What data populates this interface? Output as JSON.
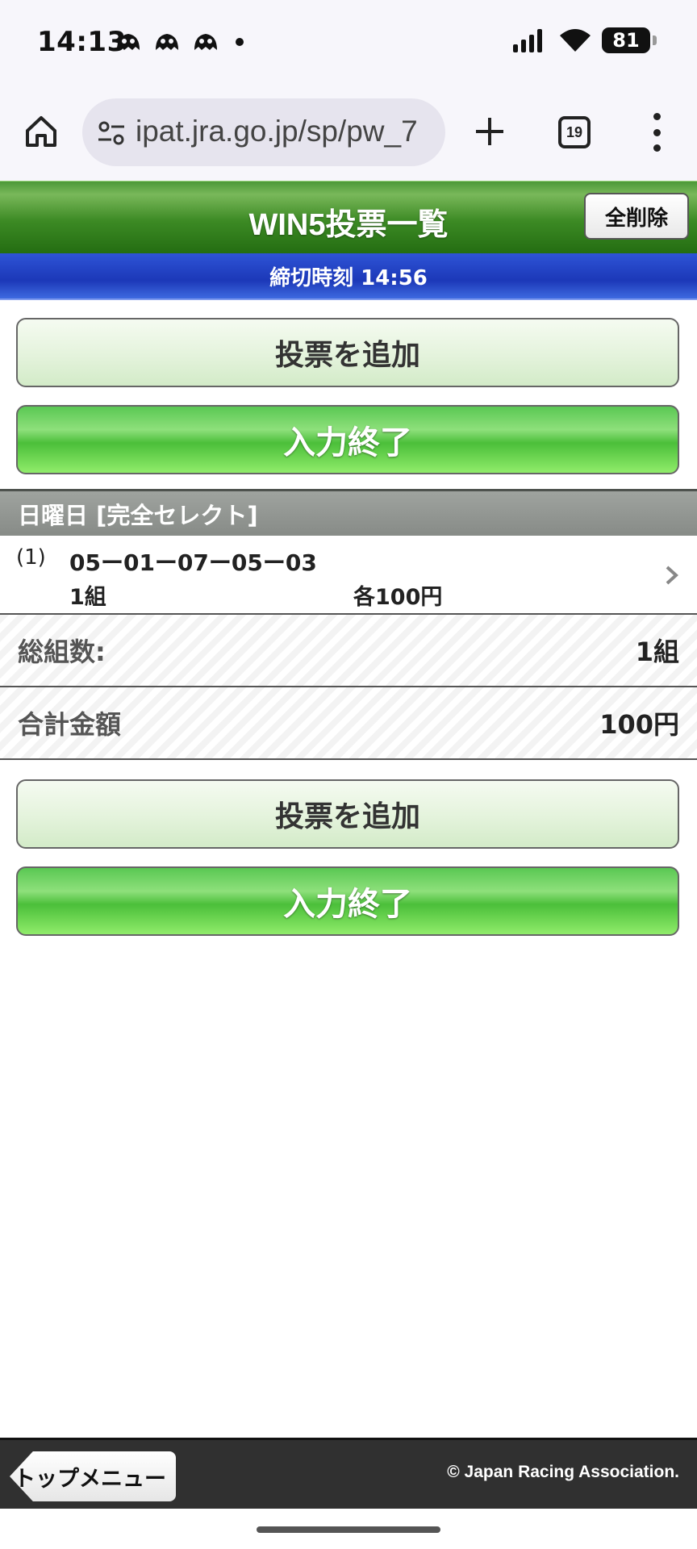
{
  "status_bar": {
    "time": "14:13",
    "notification_icons": [
      "ghost-icon",
      "ghost-icon",
      "ghost-icon"
    ],
    "battery": "81",
    "signal_icon": "cell-signal-icon",
    "wifi_icon": "wifi-icon"
  },
  "browser": {
    "url": "ipat.jra.go.jp/sp/pw_7",
    "tab_count": "19",
    "icons": [
      "home-icon",
      "site-settings-icon",
      "new-tab-icon",
      "tab-switcher-icon",
      "more-menu-icon"
    ]
  },
  "header": {
    "title": "WIN5投票一覧",
    "delete_all_label": "全削除",
    "deadline": "締切時刻 14:56",
    "color": "#2f7d1c"
  },
  "buttons": {
    "add_vote_label": "投票を追加",
    "finish_input_label": "入力終了"
  },
  "entries_section": {
    "title": "日曜日 [完全セレクト]",
    "entries": [
      {
        "index": "(1)",
        "combination": "05ー01ー07ー05ー03",
        "count": "1組",
        "amount": "各100円"
      }
    ]
  },
  "summary": {
    "total_combinations_label": "総組数:",
    "total_combinations_value": "1組",
    "total_amount_label": "合計金額",
    "total_amount_value": "100円"
  },
  "footer": {
    "top_menu_label": "トップメニュー",
    "copyright": "© Japan Racing Association."
  },
  "colors": {
    "green_header": "#2f7d1c",
    "blue_deadline": "#2443c4",
    "finish_button": "#5ac853",
    "add_button": "#e4f3dc",
    "footer_bg": "#303030"
  }
}
